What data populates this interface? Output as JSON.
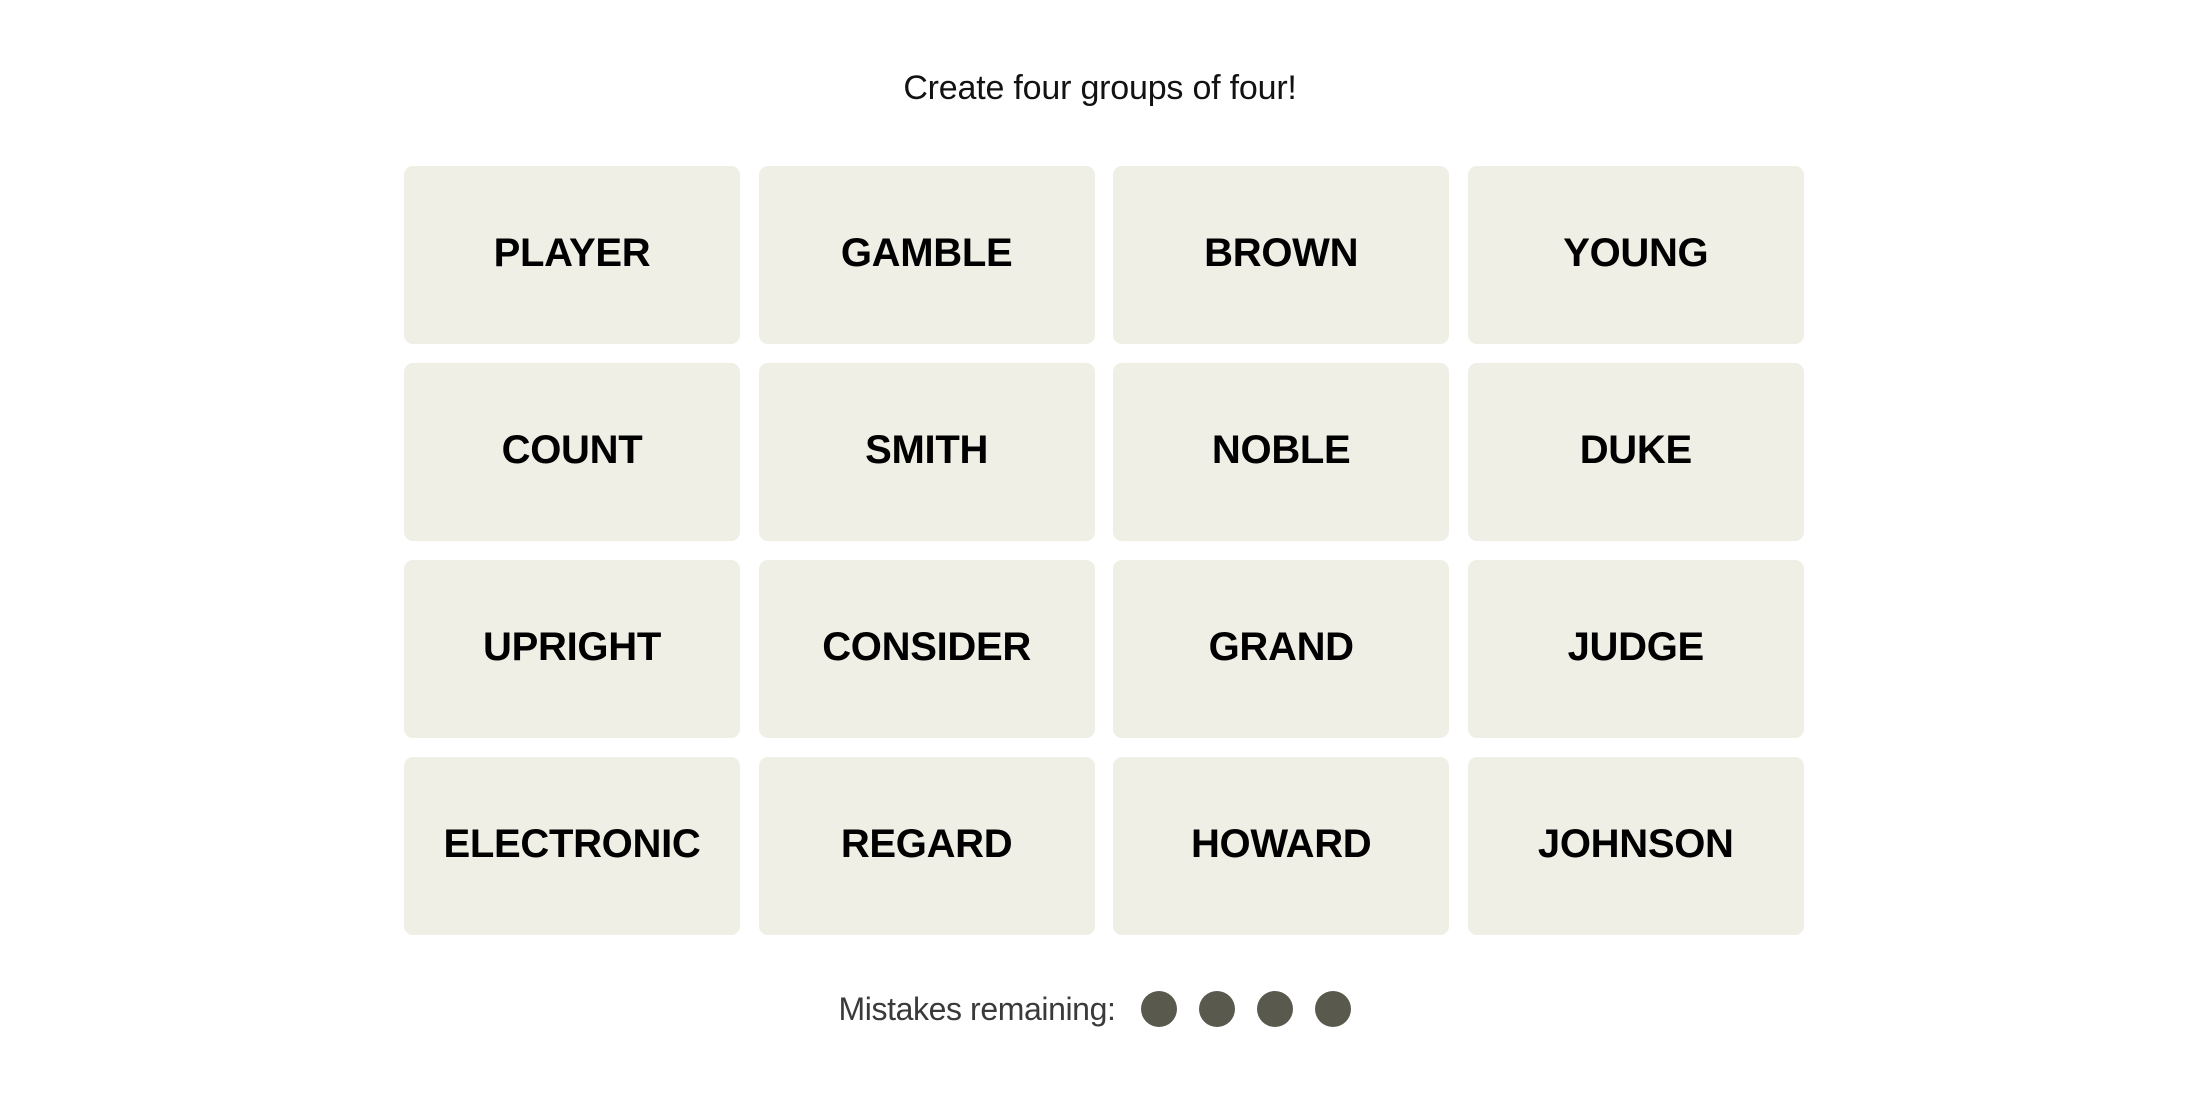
{
  "header": {
    "instruction": "Create four groups of four!"
  },
  "board": {
    "tiles": [
      {
        "word": "PLAYER"
      },
      {
        "word": "GAMBLE"
      },
      {
        "word": "BROWN"
      },
      {
        "word": "YOUNG"
      },
      {
        "word": "COUNT"
      },
      {
        "word": "SMITH"
      },
      {
        "word": "NOBLE"
      },
      {
        "word": "DUKE"
      },
      {
        "word": "UPRIGHT"
      },
      {
        "word": "CONSIDER"
      },
      {
        "word": "GRAND"
      },
      {
        "word": "JUDGE"
      },
      {
        "word": "ELECTRONIC"
      },
      {
        "word": "REGARD"
      },
      {
        "word": "HOWARD"
      },
      {
        "word": "JOHNSON"
      }
    ]
  },
  "status": {
    "mistakes_label": "Mistakes remaining:",
    "mistakes_remaining": 4,
    "mistakes_total": 4
  },
  "colors": {
    "tile_background": "#efefe6",
    "mistake_dot": "#5a594e"
  }
}
